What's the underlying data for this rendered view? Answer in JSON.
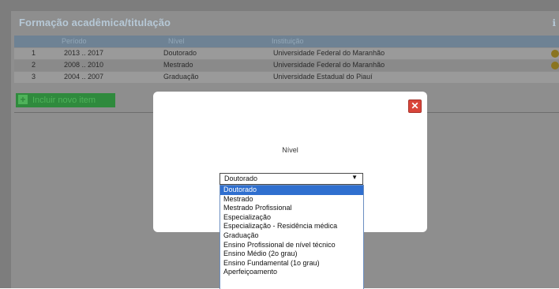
{
  "panel": {
    "title": "Formação acadêmica/titulação",
    "corner": "ℹ",
    "columns": [
      "Período",
      "Nível",
      "Instituição"
    ],
    "rows": [
      {
        "num": "1",
        "period": "2013 .. 2017",
        "level": "Doutorado",
        "institution": "Universidade Federal do Maranhão"
      },
      {
        "num": "2",
        "period": "2008 .. 2010",
        "level": "Mestrado",
        "institution": "Universidade Federal do Maranhão"
      },
      {
        "num": "3",
        "period": "2004 .. 2007",
        "level": "Graduação",
        "institution": "Universidade Estadual do Piauí"
      }
    ],
    "add_button": "Incluir novo item",
    "add_icon": "+"
  },
  "modal": {
    "close_label": "✕",
    "label": "Nível",
    "select_value": "Doutorado",
    "select_arrow": "▼",
    "options": [
      "Doutorado",
      "Mestrado",
      "Mestrado Profissional",
      "Especialização",
      "Especialização - Residência médica",
      "Graduação",
      "Ensino Profissional de nível técnico",
      "Ensino Médio (2o grau)",
      "Ensino Fundamental (1o grau)",
      "Aperfeiçoamento"
    ],
    "selected_index": 0
  },
  "colors": {
    "overlay": "#7d7d7d",
    "accent_green": "#2f8a3d",
    "selected_option": "#2f6fcf",
    "close_button": "#d9453a"
  }
}
